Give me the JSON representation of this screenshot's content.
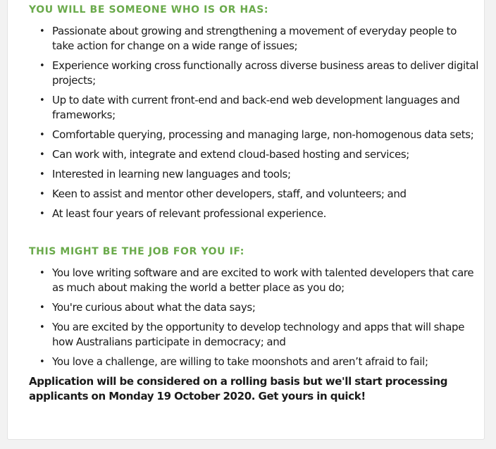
{
  "section1": {
    "heading": "YOU WILL BE SOMEONE WHO IS OR HAS:",
    "items": [
      "Passionate about growing and strengthening a movement of everyday people to take action for change on a wide range of issues;",
      "Experience working cross functionally across diverse business areas to deliver digital projects;",
      "Up to date with current front-end and back-end web development languages and frameworks;",
      "Comfortable querying, processing and managing large, non-homogenous data sets;",
      "Can work with, integrate and extend cloud-based hosting and services;",
      "Interested in learning new languages and tools;",
      "Keen to assist and mentor other developers, staff, and volunteers; and",
      "At least four years of relevant professional experience."
    ]
  },
  "section2": {
    "heading": "THIS MIGHT BE THE JOB FOR YOU IF:",
    "items": [
      "You love writing software and are excited to work with talented developers that care as much about making the world a better place as you do;",
      "You're curious about what the data says;",
      "You are excited by the opportunity to develop technology and apps that will shape how Australians participate in democracy; and",
      "You love a challenge, are willing to take moonshots and aren’t afraid to fail;"
    ]
  },
  "closing": "Application will be considered on a rolling basis but we'll start processing applicants on Monday 19 October 2020. Get yours in quick!",
  "colors": {
    "heading": "#6aaa4b",
    "text": "#1a1a1a",
    "background": "#f2f2f2",
    "card": "#ffffff"
  }
}
